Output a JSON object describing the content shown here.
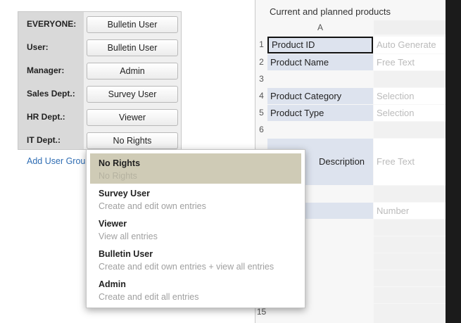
{
  "permissions": {
    "rows": [
      {
        "label": "EVERYONE:",
        "value": "Bulletin User"
      },
      {
        "label": "User:",
        "value": "Bulletin User"
      },
      {
        "label": "Manager:",
        "value": "Admin"
      },
      {
        "label": "Sales Dept.:",
        "value": "Survey User"
      },
      {
        "label": "HR Dept.:",
        "value": "Viewer"
      },
      {
        "label": "IT Dept.:",
        "value": "No Rights"
      }
    ],
    "add_group_label": "Add User Grou"
  },
  "dropdown": {
    "options": [
      {
        "title": "No Rights",
        "desc": "No Rights",
        "selected": true
      },
      {
        "title": "Survey User",
        "desc": "Create and edit own entries"
      },
      {
        "title": "Viewer",
        "desc": "View all entries"
      },
      {
        "title": "Bulletin User",
        "desc": "Create and edit own entries + view all entries"
      },
      {
        "title": "Admin",
        "desc": "Create and edit all entries"
      }
    ]
  },
  "sheet": {
    "title": "Current and planned products",
    "column_a": "A",
    "rows": [
      {
        "num": "1",
        "a": "Product ID",
        "b": "Auto Generate"
      },
      {
        "num": "2",
        "a": "Product Name",
        "b": "Free Text"
      },
      {
        "num": "3",
        "a": "",
        "b": ""
      },
      {
        "num": "4",
        "a": "Product Category",
        "b": "Selection"
      },
      {
        "num": "5",
        "a": "Product Type",
        "b": "Selection"
      },
      {
        "num": "6",
        "a": "",
        "b": ""
      },
      {
        "num": "",
        "a": "Description",
        "b": "Free Text"
      },
      {
        "num": "",
        "a": "",
        "b": "Number"
      },
      {
        "num": "15",
        "a": "",
        "b": ""
      }
    ]
  }
}
